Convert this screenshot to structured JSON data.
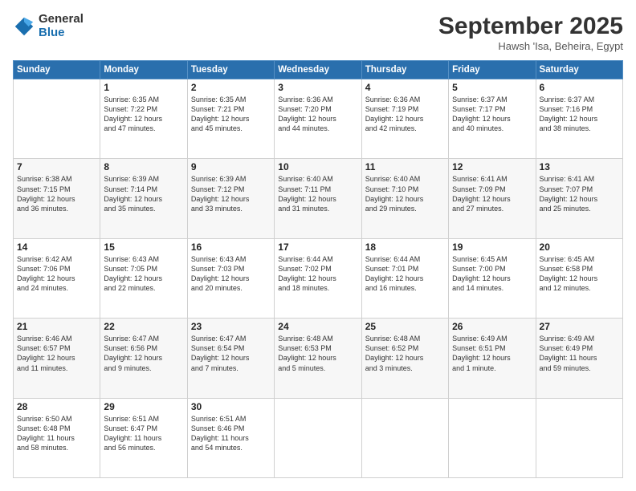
{
  "logo": {
    "general": "General",
    "blue": "Blue"
  },
  "title": "September 2025",
  "location": "Hawsh 'Isa, Beheira, Egypt",
  "days": [
    "Sunday",
    "Monday",
    "Tuesday",
    "Wednesday",
    "Thursday",
    "Friday",
    "Saturday"
  ],
  "weeks": [
    [
      {
        "day": null,
        "text": ""
      },
      {
        "day": "1",
        "text": "Sunrise: 6:35 AM\nSunset: 7:22 PM\nDaylight: 12 hours\nand 47 minutes."
      },
      {
        "day": "2",
        "text": "Sunrise: 6:35 AM\nSunset: 7:21 PM\nDaylight: 12 hours\nand 45 minutes."
      },
      {
        "day": "3",
        "text": "Sunrise: 6:36 AM\nSunset: 7:20 PM\nDaylight: 12 hours\nand 44 minutes."
      },
      {
        "day": "4",
        "text": "Sunrise: 6:36 AM\nSunset: 7:19 PM\nDaylight: 12 hours\nand 42 minutes."
      },
      {
        "day": "5",
        "text": "Sunrise: 6:37 AM\nSunset: 7:17 PM\nDaylight: 12 hours\nand 40 minutes."
      },
      {
        "day": "6",
        "text": "Sunrise: 6:37 AM\nSunset: 7:16 PM\nDaylight: 12 hours\nand 38 minutes."
      }
    ],
    [
      {
        "day": "7",
        "text": "Sunrise: 6:38 AM\nSunset: 7:15 PM\nDaylight: 12 hours\nand 36 minutes."
      },
      {
        "day": "8",
        "text": "Sunrise: 6:39 AM\nSunset: 7:14 PM\nDaylight: 12 hours\nand 35 minutes."
      },
      {
        "day": "9",
        "text": "Sunrise: 6:39 AM\nSunset: 7:12 PM\nDaylight: 12 hours\nand 33 minutes."
      },
      {
        "day": "10",
        "text": "Sunrise: 6:40 AM\nSunset: 7:11 PM\nDaylight: 12 hours\nand 31 minutes."
      },
      {
        "day": "11",
        "text": "Sunrise: 6:40 AM\nSunset: 7:10 PM\nDaylight: 12 hours\nand 29 minutes."
      },
      {
        "day": "12",
        "text": "Sunrise: 6:41 AM\nSunset: 7:09 PM\nDaylight: 12 hours\nand 27 minutes."
      },
      {
        "day": "13",
        "text": "Sunrise: 6:41 AM\nSunset: 7:07 PM\nDaylight: 12 hours\nand 25 minutes."
      }
    ],
    [
      {
        "day": "14",
        "text": "Sunrise: 6:42 AM\nSunset: 7:06 PM\nDaylight: 12 hours\nand 24 minutes."
      },
      {
        "day": "15",
        "text": "Sunrise: 6:43 AM\nSunset: 7:05 PM\nDaylight: 12 hours\nand 22 minutes."
      },
      {
        "day": "16",
        "text": "Sunrise: 6:43 AM\nSunset: 7:03 PM\nDaylight: 12 hours\nand 20 minutes."
      },
      {
        "day": "17",
        "text": "Sunrise: 6:44 AM\nSunset: 7:02 PM\nDaylight: 12 hours\nand 18 minutes."
      },
      {
        "day": "18",
        "text": "Sunrise: 6:44 AM\nSunset: 7:01 PM\nDaylight: 12 hours\nand 16 minutes."
      },
      {
        "day": "19",
        "text": "Sunrise: 6:45 AM\nSunset: 7:00 PM\nDaylight: 12 hours\nand 14 minutes."
      },
      {
        "day": "20",
        "text": "Sunrise: 6:45 AM\nSunset: 6:58 PM\nDaylight: 12 hours\nand 12 minutes."
      }
    ],
    [
      {
        "day": "21",
        "text": "Sunrise: 6:46 AM\nSunset: 6:57 PM\nDaylight: 12 hours\nand 11 minutes."
      },
      {
        "day": "22",
        "text": "Sunrise: 6:47 AM\nSunset: 6:56 PM\nDaylight: 12 hours\nand 9 minutes."
      },
      {
        "day": "23",
        "text": "Sunrise: 6:47 AM\nSunset: 6:54 PM\nDaylight: 12 hours\nand 7 minutes."
      },
      {
        "day": "24",
        "text": "Sunrise: 6:48 AM\nSunset: 6:53 PM\nDaylight: 12 hours\nand 5 minutes."
      },
      {
        "day": "25",
        "text": "Sunrise: 6:48 AM\nSunset: 6:52 PM\nDaylight: 12 hours\nand 3 minutes."
      },
      {
        "day": "26",
        "text": "Sunrise: 6:49 AM\nSunset: 6:51 PM\nDaylight: 12 hours\nand 1 minute."
      },
      {
        "day": "27",
        "text": "Sunrise: 6:49 AM\nSunset: 6:49 PM\nDaylight: 11 hours\nand 59 minutes."
      }
    ],
    [
      {
        "day": "28",
        "text": "Sunrise: 6:50 AM\nSunset: 6:48 PM\nDaylight: 11 hours\nand 58 minutes."
      },
      {
        "day": "29",
        "text": "Sunrise: 6:51 AM\nSunset: 6:47 PM\nDaylight: 11 hours\nand 56 minutes."
      },
      {
        "day": "30",
        "text": "Sunrise: 6:51 AM\nSunset: 6:46 PM\nDaylight: 11 hours\nand 54 minutes."
      },
      {
        "day": null,
        "text": ""
      },
      {
        "day": null,
        "text": ""
      },
      {
        "day": null,
        "text": ""
      },
      {
        "day": null,
        "text": ""
      }
    ]
  ]
}
